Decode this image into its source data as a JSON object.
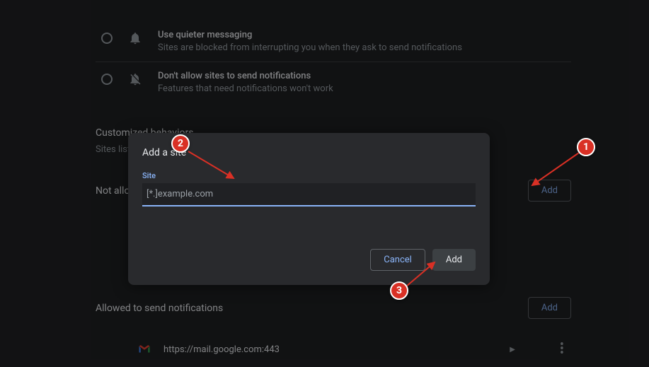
{
  "defaults": {
    "quieter": {
      "title": "Use quieter messaging",
      "desc": "Sites are blocked from interrupting you when they ask to send notifications"
    },
    "block": {
      "title": "Don't allow sites to send notifications",
      "desc": "Features that need notifications won't work"
    }
  },
  "customized": {
    "header": "Customized behaviors",
    "sub": "Sites listed below follow a custom setting instead of the default"
  },
  "notAllowed": {
    "header": "Not allowed to send notifications",
    "addLabel": "Add"
  },
  "allowed": {
    "header": "Allowed to send notifications",
    "addLabel": "Add",
    "site1": "https://mail.google.com:443"
  },
  "dialog": {
    "title": "Add a site",
    "fieldLabel": "Site",
    "placeholder": "[*.]example.com",
    "cancel": "Cancel",
    "add": "Add"
  },
  "markers": {
    "m1": "1",
    "m2": "2",
    "m3": "3"
  }
}
